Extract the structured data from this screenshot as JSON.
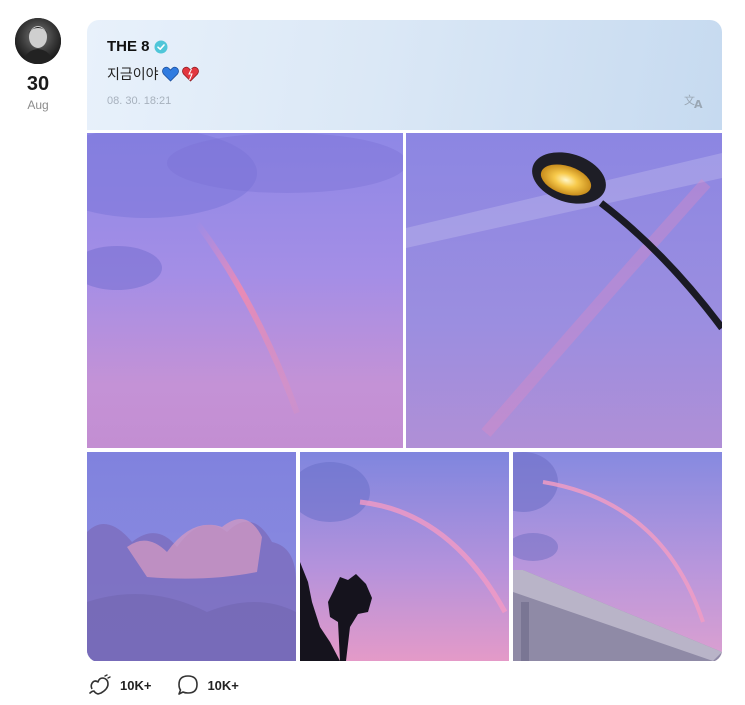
{
  "post": {
    "day": "30",
    "month": "Aug",
    "author": "THE 8",
    "text": "지금이야",
    "timestamp": "08. 30. 18:21",
    "verified_color": "#4fc6d9",
    "header_gradient": [
      "#e8f1fb",
      "#c6daf0"
    ]
  },
  "icons": {
    "avatar": "avatar",
    "verified": "verified-badge-icon",
    "translate": "translate-icon",
    "emoji_1": "blue-heart-icon",
    "emoji_2": "red-heart-icon",
    "reaction": "heart-reaction-icon",
    "comment": "comment-icon"
  },
  "photos": [
    {
      "alt": "purple sky with rainbow"
    },
    {
      "alt": "street lamp with rainbow"
    },
    {
      "alt": "pink clouds"
    },
    {
      "alt": "rainbow over trees"
    },
    {
      "alt": "rainbow over bridge"
    }
  ],
  "actions": {
    "reactions_count": "10K+",
    "comments_count": "10K+"
  }
}
